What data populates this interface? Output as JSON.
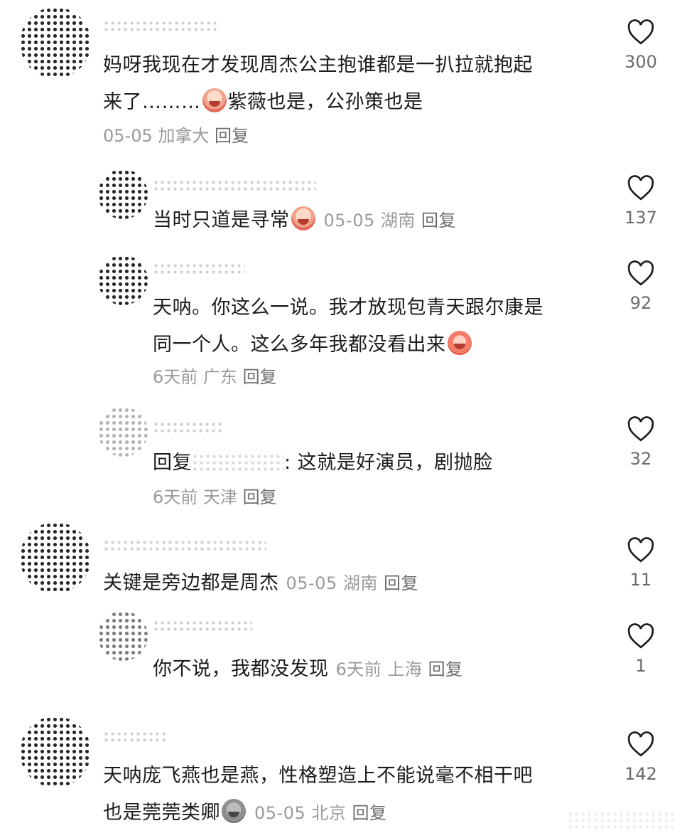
{
  "comments": [
    {
      "text_lines": [
        "妈呀我现在才发现周杰公主抱谁都是一扒拉就抱起",
        "来了………",
        "紫薇也是，公孙策也是"
      ],
      "date": "05-05",
      "location": "加拿大",
      "reply_label": "回复",
      "likes": "300"
    },
    {
      "text": "当时只道是寻常",
      "date": "05-05",
      "location": "湖南",
      "reply_label": "回复",
      "likes": "137"
    },
    {
      "text_lines": [
        "天呐。你这么一说。我才放现包青天跟尔康是",
        "同一个人。这么多年我都没看出来"
      ],
      "date": "6天前",
      "location": "广东",
      "reply_label": "回复",
      "likes": "92"
    },
    {
      "prefix": "回复",
      "text": ": 这就是好演员，剧抛脸",
      "date": "6天前",
      "location": "天津",
      "reply_label": "回复",
      "likes": "32"
    },
    {
      "text": "关键是旁边都是周杰",
      "date": "05-05",
      "location": "湖南",
      "reply_label": "回复",
      "likes": "11"
    },
    {
      "text": "你不说，我都没发现",
      "date": "6天前",
      "location": "上海",
      "reply_label": "回复",
      "likes": "1"
    },
    {
      "text_lines": [
        "天呐庞飞燕也是燕，性格塑造上不能说毫不相干吧",
        "也是莞莞类卿"
      ],
      "date": "05-05",
      "location": "北京",
      "reply_label": "回复",
      "likes": "142"
    }
  ],
  "icons": {
    "like": "heart-outline-icon",
    "emoji_cry": "crying-emoji-icon",
    "emoji_sweat": "sweat-laugh-emoji-icon",
    "emoji_grey": "sad-grey-emoji-icon"
  }
}
